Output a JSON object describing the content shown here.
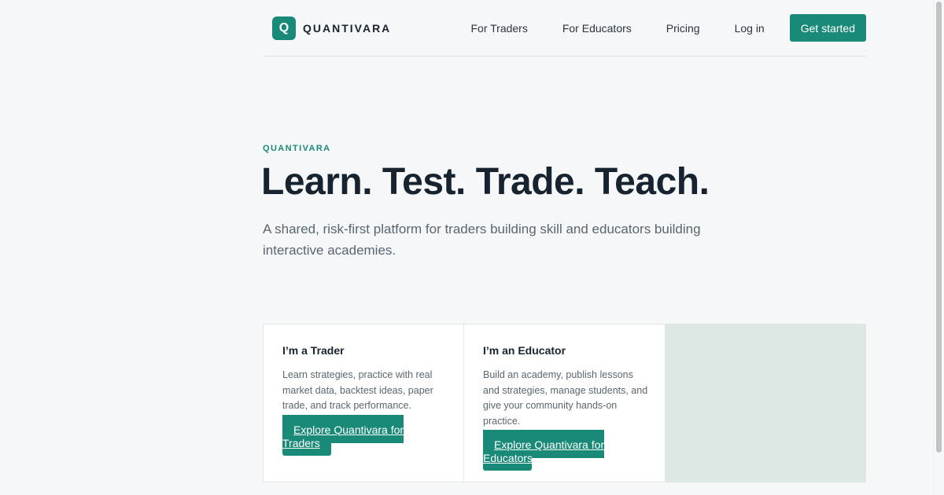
{
  "brand": {
    "logo_letter": "Q",
    "name": "QUANTIVARA",
    "accent_color": "#1a8a78"
  },
  "nav": {
    "items": [
      {
        "label": "For Traders"
      },
      {
        "label": "For Educators"
      },
      {
        "label": "Pricing"
      },
      {
        "label": "Log in"
      }
    ],
    "cta_label": "Get started"
  },
  "hero": {
    "eyebrow": "QUANTIVARA",
    "title": "Learn. Test. Trade. Teach.",
    "subtitle": "A shared, risk-first platform for traders building skill and educators building interactive academies."
  },
  "cards": [
    {
      "title": "I’m a Trader",
      "description": "Learn strategies, practice with real market data, backtest ideas, paper trade, and track performance.",
      "button_label": "Explore Quantivara for Traders"
    },
    {
      "title": "I’m an Educator",
      "description": "Build an academy, publish lessons and strategies, manage students, and give your community hands-on practice.",
      "button_label": "Explore Quantivara for Educators"
    }
  ]
}
